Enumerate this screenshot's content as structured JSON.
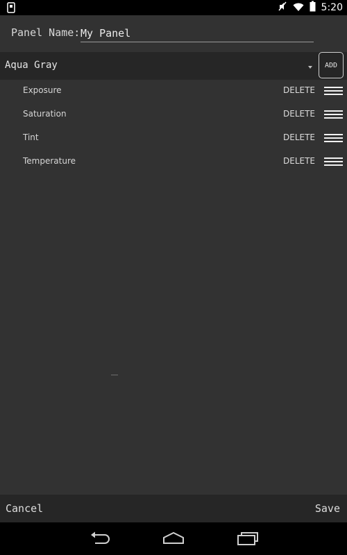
{
  "status_bar": {
    "time": "5:20",
    "icons": [
      "screenshot-icon",
      "mute-icon",
      "wifi-icon",
      "battery-icon"
    ]
  },
  "panel": {
    "label": "Panel Name:",
    "name_value": "My Panel"
  },
  "preset": {
    "selected": "Aqua Gray",
    "add_label": "ADD"
  },
  "adjustments": [
    {
      "label": "Exposure",
      "delete": "DELETE"
    },
    {
      "label": "Saturation",
      "delete": "DELETE"
    },
    {
      "label": "Tint",
      "delete": "DELETE"
    },
    {
      "label": "Temperature",
      "delete": "DELETE"
    }
  ],
  "footer": {
    "cancel": "Cancel",
    "save": "Save"
  },
  "nav": {
    "icons": [
      "back-icon",
      "home-icon",
      "recents-icon"
    ]
  },
  "colors": {
    "background": "#323232",
    "bars": "#262626",
    "system_bars": "#000000"
  }
}
